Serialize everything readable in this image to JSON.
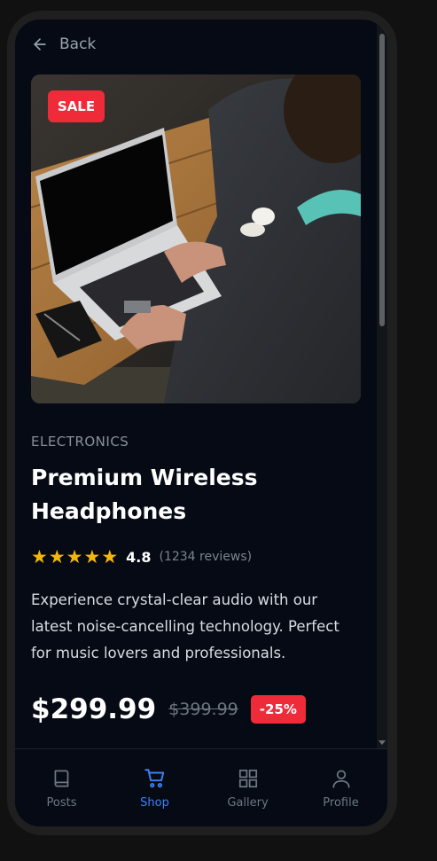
{
  "header": {
    "back_label": "Back"
  },
  "product": {
    "badge": "SALE",
    "category": "ELECTRONICS",
    "title": "Premium Wireless Headphones",
    "stars": 5,
    "rating": "4.8",
    "reviews": "(1234 reviews)",
    "description": "Experience crystal-clear audio with our latest noise-cancelling technology. Perfect for music lovers and professionals.",
    "price": "$299.99",
    "old_price": "$399.99",
    "discount": "-25%"
  },
  "nav": {
    "items": [
      {
        "label": "Posts",
        "icon": "book-icon",
        "active": false
      },
      {
        "label": "Shop",
        "icon": "cart-icon",
        "active": true
      },
      {
        "label": "Gallery",
        "icon": "grid-icon",
        "active": false
      },
      {
        "label": "Profile",
        "icon": "user-icon",
        "active": false
      }
    ]
  },
  "colors": {
    "background": "#050a14",
    "accent": "#3b82f6",
    "sale": "#ef2b3a",
    "star": "#f5b60b"
  }
}
